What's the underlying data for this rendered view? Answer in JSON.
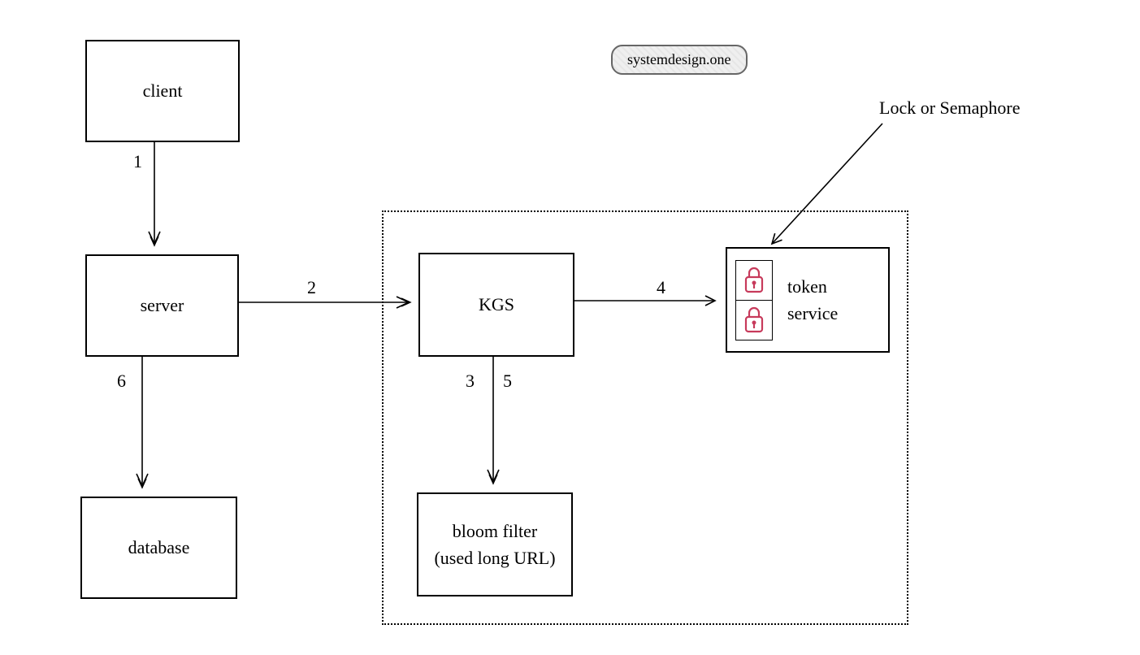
{
  "badge": {
    "text": "systemdesign.one"
  },
  "nodes": {
    "client": "client",
    "server": "server",
    "database": "database",
    "kgs": "KGS",
    "bloom_line1": "bloom filter",
    "bloom_line2": "(used long URL)",
    "token_line1": "token",
    "token_line2": "service"
  },
  "annotation": {
    "lock": "Lock or Semaphore"
  },
  "steps": {
    "s1": "1",
    "s2": "2",
    "s3": "3",
    "s4": "4",
    "s5": "5",
    "s6": "6"
  },
  "icons": {
    "lock_top": "lock-icon",
    "lock_bottom": "lock-icon"
  }
}
